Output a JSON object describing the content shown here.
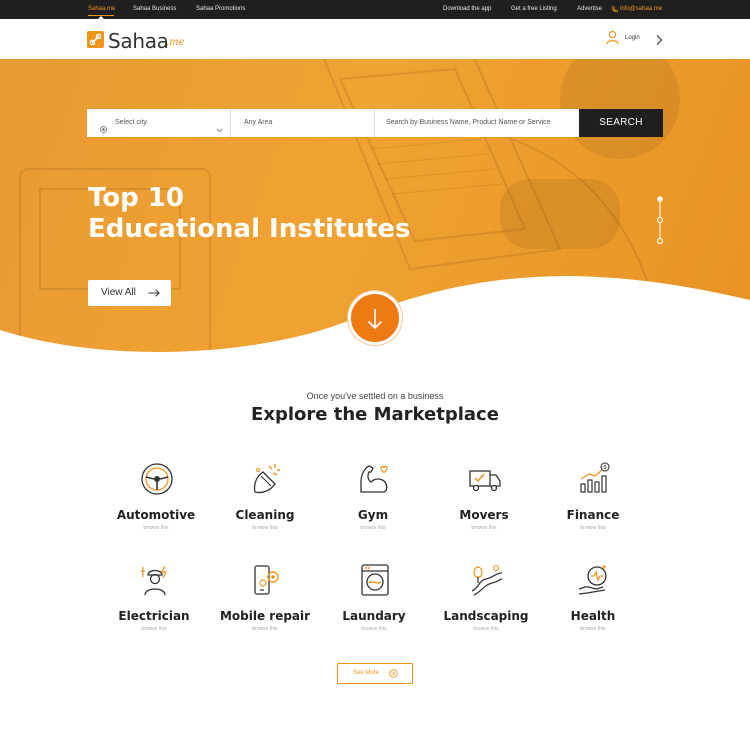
{
  "topbar": {
    "tabs": [
      "Sahaa.me",
      "Sahaa Business",
      "Sahaa Promotions"
    ],
    "links": [
      "Download the app",
      "Get a free Listing",
      "Advertise"
    ],
    "email": "info@sahaa.me"
  },
  "header": {
    "logo_text": "Sahaa",
    "logo_suffix": ".me",
    "login_label": "Login"
  },
  "search": {
    "city_placeholder": "Select city",
    "area_placeholder": "Any Area",
    "query_placeholder": "Search by Business Name, Product Name or Service",
    "button_label": "SEARCH"
  },
  "hero": {
    "title_line1": "Top 10",
    "title_line2": "Educational Institutes",
    "cta_label": "View All"
  },
  "marketplace": {
    "subtitle": "Once you've settled on a business",
    "title": "Explore the Marketplace",
    "categories": [
      {
        "name": "Automotive",
        "sub": "browse this",
        "icon": "steering-wheel-icon"
      },
      {
        "name": "Cleaning",
        "sub": "browse this",
        "icon": "cleaning-spray-icon"
      },
      {
        "name": "Gym",
        "sub": "browse this",
        "icon": "muscle-arm-icon"
      },
      {
        "name": "Movers",
        "sub": "browse this",
        "icon": "moving-truck-icon"
      },
      {
        "name": "Finance",
        "sub": "browse this",
        "icon": "finance-chart-icon"
      },
      {
        "name": "Electrician",
        "sub": "browse this",
        "icon": "electrician-icon"
      },
      {
        "name": "Mobile repair",
        "sub": "browse this",
        "icon": "mobile-repair-icon"
      },
      {
        "name": "Laundary",
        "sub": "browse this",
        "icon": "washing-machine-icon"
      },
      {
        "name": "Landscaping",
        "sub": "browse this",
        "icon": "landscaping-icon"
      },
      {
        "name": "Health",
        "sub": "browse this",
        "icon": "health-hand-icon"
      }
    ],
    "see_more_label": "See More"
  },
  "colors": {
    "accent": "#f0941a",
    "accent_dark": "#ee7a13",
    "topbar_bg": "#1f1f1f",
    "search_button_bg": "#1f1f1f"
  }
}
